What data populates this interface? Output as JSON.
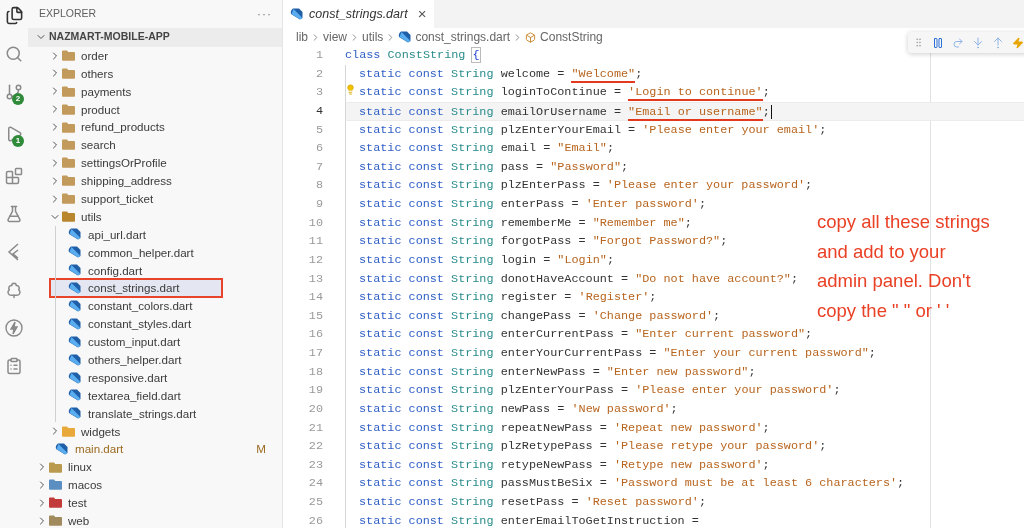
{
  "activity_badges": {
    "source_control": "2",
    "run": "1"
  },
  "explorer": {
    "title": "EXPLORER",
    "more": "···",
    "root": {
      "label": "NAZMART-MOBILE-APP",
      "expanded": true
    },
    "tree": [
      {
        "kind": "scrolled",
        "children": [
          {
            "label": "order",
            "kind": "folder",
            "expanded": false,
            "selected": false,
            "color": "#c29a5b"
          },
          {
            "label": "others",
            "kind": "folder",
            "expanded": false,
            "selected": false,
            "color": "#c29a5b"
          },
          {
            "label": "payments",
            "kind": "folder",
            "expanded": false,
            "selected": false,
            "color": "#c29a5b"
          },
          {
            "label": "product",
            "kind": "folder",
            "expanded": false,
            "selected": false,
            "color": "#c29a5b"
          },
          {
            "label": "refund_products",
            "kind": "folder",
            "expanded": false,
            "selected": false,
            "color": "#c29a5b"
          },
          {
            "label": "search",
            "kind": "folder",
            "expanded": false,
            "selected": false,
            "color": "#c29a5b"
          },
          {
            "label": "settingsOrProfile",
            "kind": "folder",
            "expanded": false,
            "selected": false,
            "color": "#c29a5b"
          },
          {
            "label": "shipping_address",
            "kind": "folder",
            "expanded": false,
            "selected": false,
            "color": "#c29a5b"
          },
          {
            "label": "support_ticket",
            "kind": "folder",
            "expanded": false,
            "selected": false,
            "color": "#c29a5b"
          },
          {
            "label": "utils",
            "kind": "folder",
            "expanded": true,
            "selected": false,
            "color": "#b8862e",
            "children": [
              {
                "label": "api_url.dart",
                "kind": "file",
                "selected": false
              },
              {
                "label": "common_helper.dart",
                "kind": "file",
                "selected": false
              },
              {
                "label": "config.dart",
                "kind": "file",
                "selected": false
              },
              {
                "label": "const_strings.dart",
                "kind": "file",
                "selected": true,
                "annotated": true
              },
              {
                "label": "constant_colors.dart",
                "kind": "file",
                "selected": false
              },
              {
                "label": "constant_styles.dart",
                "kind": "file",
                "selected": false
              },
              {
                "label": "custom_input.dart",
                "kind": "file",
                "selected": false
              },
              {
                "label": "others_helper.dart",
                "kind": "file",
                "selected": false
              },
              {
                "label": "responsive.dart",
                "kind": "file",
                "selected": false
              },
              {
                "label": "textarea_field.dart",
                "kind": "file",
                "selected": false
              },
              {
                "label": "translate_strings.dart",
                "kind": "file",
                "selected": false
              }
            ]
          },
          {
            "label": "widgets",
            "kind": "folder",
            "expanded": false,
            "selected": false,
            "color": "#e8a83a"
          },
          {
            "label": "main.dart",
            "kind": "file",
            "selected": false,
            "modified": true,
            "status": "M"
          }
        ]
      },
      {
        "label": "linux",
        "kind": "folder",
        "expanded": false,
        "selected": false,
        "color": "#b99a4e"
      },
      {
        "label": "macos",
        "kind": "folder",
        "expanded": false,
        "selected": false,
        "color": "#5b8fc2"
      },
      {
        "label": "test",
        "kind": "folder",
        "expanded": false,
        "selected": false,
        "color": "#c23a3a"
      },
      {
        "label": "web",
        "kind": "folder",
        "expanded": false,
        "selected": false,
        "color": "#a08a5e"
      }
    ]
  },
  "tab": {
    "label": "const_strings.dart",
    "close": "×",
    "preview": true
  },
  "breadcrumb": [
    {
      "label": "lib"
    },
    {
      "label": "view"
    },
    {
      "label": "utils"
    },
    {
      "label": "const_strings.dart",
      "kind": "file"
    },
    {
      "label": "ConstString",
      "kind": "class"
    }
  ],
  "lines": [
    {
      "number": "1",
      "kind": "class",
      "keyword": "class",
      "name": "ConstString",
      "brace": "{"
    },
    {
      "number": "2",
      "kind": "field",
      "modifiers": "static const",
      "type": "String",
      "name": "welcome",
      "op": "=",
      "value": "\"Welcome\"",
      "end": ";",
      "underlined": true
    },
    {
      "number": "3",
      "kind": "field",
      "modifiers": "static const",
      "type": "String",
      "name": "loginToContinue",
      "op": "=",
      "value": "'Login to continue'",
      "end": ";",
      "underlined": true,
      "hint": true
    },
    {
      "number": "4",
      "kind": "field",
      "modifiers": "static const",
      "type": "String",
      "name": "emailOrUsername",
      "op": "=",
      "value": "\"Email or username\"",
      "end": ";",
      "underlined": true,
      "current": true
    },
    {
      "number": "5",
      "kind": "field",
      "modifiers": "static const",
      "type": "String",
      "name": "plzEnterYourEmail",
      "op": "=",
      "value": "'Please enter your email'",
      "end": ";"
    },
    {
      "number": "6",
      "kind": "field",
      "modifiers": "static const",
      "type": "String",
      "name": "email",
      "op": "=",
      "value": "\"Email\"",
      "end": ";"
    },
    {
      "number": "7",
      "kind": "field",
      "modifiers": "static const",
      "type": "String",
      "name": "pass",
      "op": "=",
      "value": "\"Password\"",
      "end": ";"
    },
    {
      "number": "8",
      "kind": "field",
      "modifiers": "static const",
      "type": "String",
      "name": "plzEnterPass",
      "op": "=",
      "value": "'Please enter your password'",
      "end": ";"
    },
    {
      "number": "9",
      "kind": "field",
      "modifiers": "static const",
      "type": "String",
      "name": "enterPass",
      "op": "=",
      "value": "'Enter password'",
      "end": ";"
    },
    {
      "number": "10",
      "kind": "field",
      "modifiers": "static const",
      "type": "String",
      "name": "rememberMe",
      "op": "=",
      "value": "\"Remember me\"",
      "end": ";"
    },
    {
      "number": "11",
      "kind": "field",
      "modifiers": "static const",
      "type": "String",
      "name": "forgotPass",
      "op": "=",
      "value": "\"Forgot Password?\"",
      "end": ";"
    },
    {
      "number": "12",
      "kind": "field",
      "modifiers": "static const",
      "type": "String",
      "name": "login",
      "op": "=",
      "value": "\"Login\"",
      "end": ";"
    },
    {
      "number": "13",
      "kind": "field",
      "modifiers": "static const",
      "type": "String",
      "name": "donotHaveAccount",
      "op": "=",
      "value": "\"Do not have account?\"",
      "end": ";"
    },
    {
      "number": "14",
      "kind": "field",
      "modifiers": "static const",
      "type": "String",
      "name": "register",
      "op": "=",
      "value": "'Register'",
      "end": ";"
    },
    {
      "number": "15",
      "kind": "field",
      "modifiers": "static const",
      "type": "String",
      "name": "changePass",
      "op": "=",
      "value": "'Change password'",
      "end": ";"
    },
    {
      "number": "16",
      "kind": "field",
      "modifiers": "static const",
      "type": "String",
      "name": "enterCurrentPass",
      "op": "=",
      "value": "\"Enter current password\"",
      "end": ";"
    },
    {
      "number": "17",
      "kind": "field",
      "modifiers": "static const",
      "type": "String",
      "name": "enterYourCurrentPass",
      "op": "=",
      "value": "\"Enter your current password\"",
      "end": ";"
    },
    {
      "number": "18",
      "kind": "field",
      "modifiers": "static const",
      "type": "String",
      "name": "enterNewPass",
      "op": "=",
      "value": "\"Enter new password\"",
      "end": ";"
    },
    {
      "number": "19",
      "kind": "field",
      "modifiers": "static const",
      "type": "String",
      "name": "plzEnterYourPass",
      "op": "=",
      "value": "'Please enter your password'",
      "end": ";"
    },
    {
      "number": "20",
      "kind": "field",
      "modifiers": "static const",
      "type": "String",
      "name": "newPass",
      "op": "=",
      "value": "'New password'",
      "end": ";"
    },
    {
      "number": "21",
      "kind": "field",
      "modifiers": "static const",
      "type": "String",
      "name": "repeatNewPass",
      "op": "=",
      "value": "'Repeat new password'",
      "end": ";"
    },
    {
      "number": "22",
      "kind": "field",
      "modifiers": "static const",
      "type": "String",
      "name": "plzRetypePass",
      "op": "=",
      "value": "'Please retype your password'",
      "end": ";"
    },
    {
      "number": "23",
      "kind": "field",
      "modifiers": "static const",
      "type": "String",
      "name": "retypeNewPass",
      "op": "=",
      "value": "'Retype new password'",
      "end": ";"
    },
    {
      "number": "24",
      "kind": "field",
      "modifiers": "static const",
      "type": "String",
      "name": "passMustBeSix",
      "op": "=",
      "value": "'Password must be at least 6 characters'",
      "end": ";"
    },
    {
      "number": "25",
      "kind": "field",
      "modifiers": "static const",
      "type": "String",
      "name": "resetPass",
      "op": "=",
      "value": "'Reset password'",
      "end": ";"
    },
    {
      "number": "26",
      "kind": "field",
      "modifiers": "static const",
      "type": "String",
      "name": "enterEmailToGetInstruction",
      "op": "="
    }
  ],
  "annotation": {
    "lines": [
      "copy all these strings",
      "and add to your",
      "admin panel. Don't",
      "copy the \" \" or ' '"
    ]
  }
}
